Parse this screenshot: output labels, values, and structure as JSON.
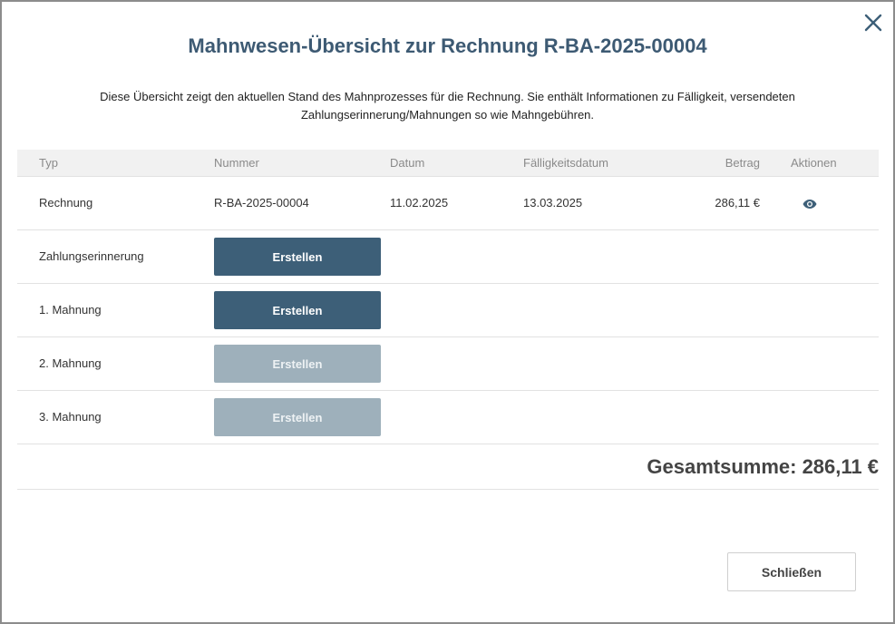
{
  "dialog": {
    "title": "Mahnwesen-Übersicht zur Rechnung R-BA-2025-00004",
    "description": "Diese Übersicht zeigt den aktuellen Stand des Mahnprozesses für die Rechnung. Sie enthält Informationen zu Fälligkeit, versendeten Zahlungserinnerung/Mahnungen so wie Mahngebühren.",
    "close_icon": "close-icon"
  },
  "table": {
    "headers": {
      "typ": "Typ",
      "nummer": "Nummer",
      "datum": "Datum",
      "faelligkeitsdatum": "Fälligkeitsdatum",
      "betrag": "Betrag",
      "aktionen": "Aktionen"
    },
    "invoice_row": {
      "typ": "Rechnung",
      "nummer": "R-BA-2025-00004",
      "datum": "11.02.2025",
      "faelligkeitsdatum": "13.03.2025",
      "betrag": "286,11 €",
      "action_icon": "eye-icon"
    },
    "reminder_rows": [
      {
        "typ": "Zahlungserinnerung",
        "button_label": "Erstellen",
        "enabled": true
      },
      {
        "typ": "1. Mahnung",
        "button_label": "Erstellen",
        "enabled": true
      },
      {
        "typ": "2. Mahnung",
        "button_label": "Erstellen",
        "enabled": false
      },
      {
        "typ": "3. Mahnung",
        "button_label": "Erstellen",
        "enabled": false
      }
    ],
    "total": "Gesamtsumme: 286,11 €"
  },
  "footer": {
    "close_label": "Schließen"
  },
  "colors": {
    "accent": "#3d5f78",
    "accent_disabled": "#9eb0bb",
    "title": "#3d5a73"
  }
}
